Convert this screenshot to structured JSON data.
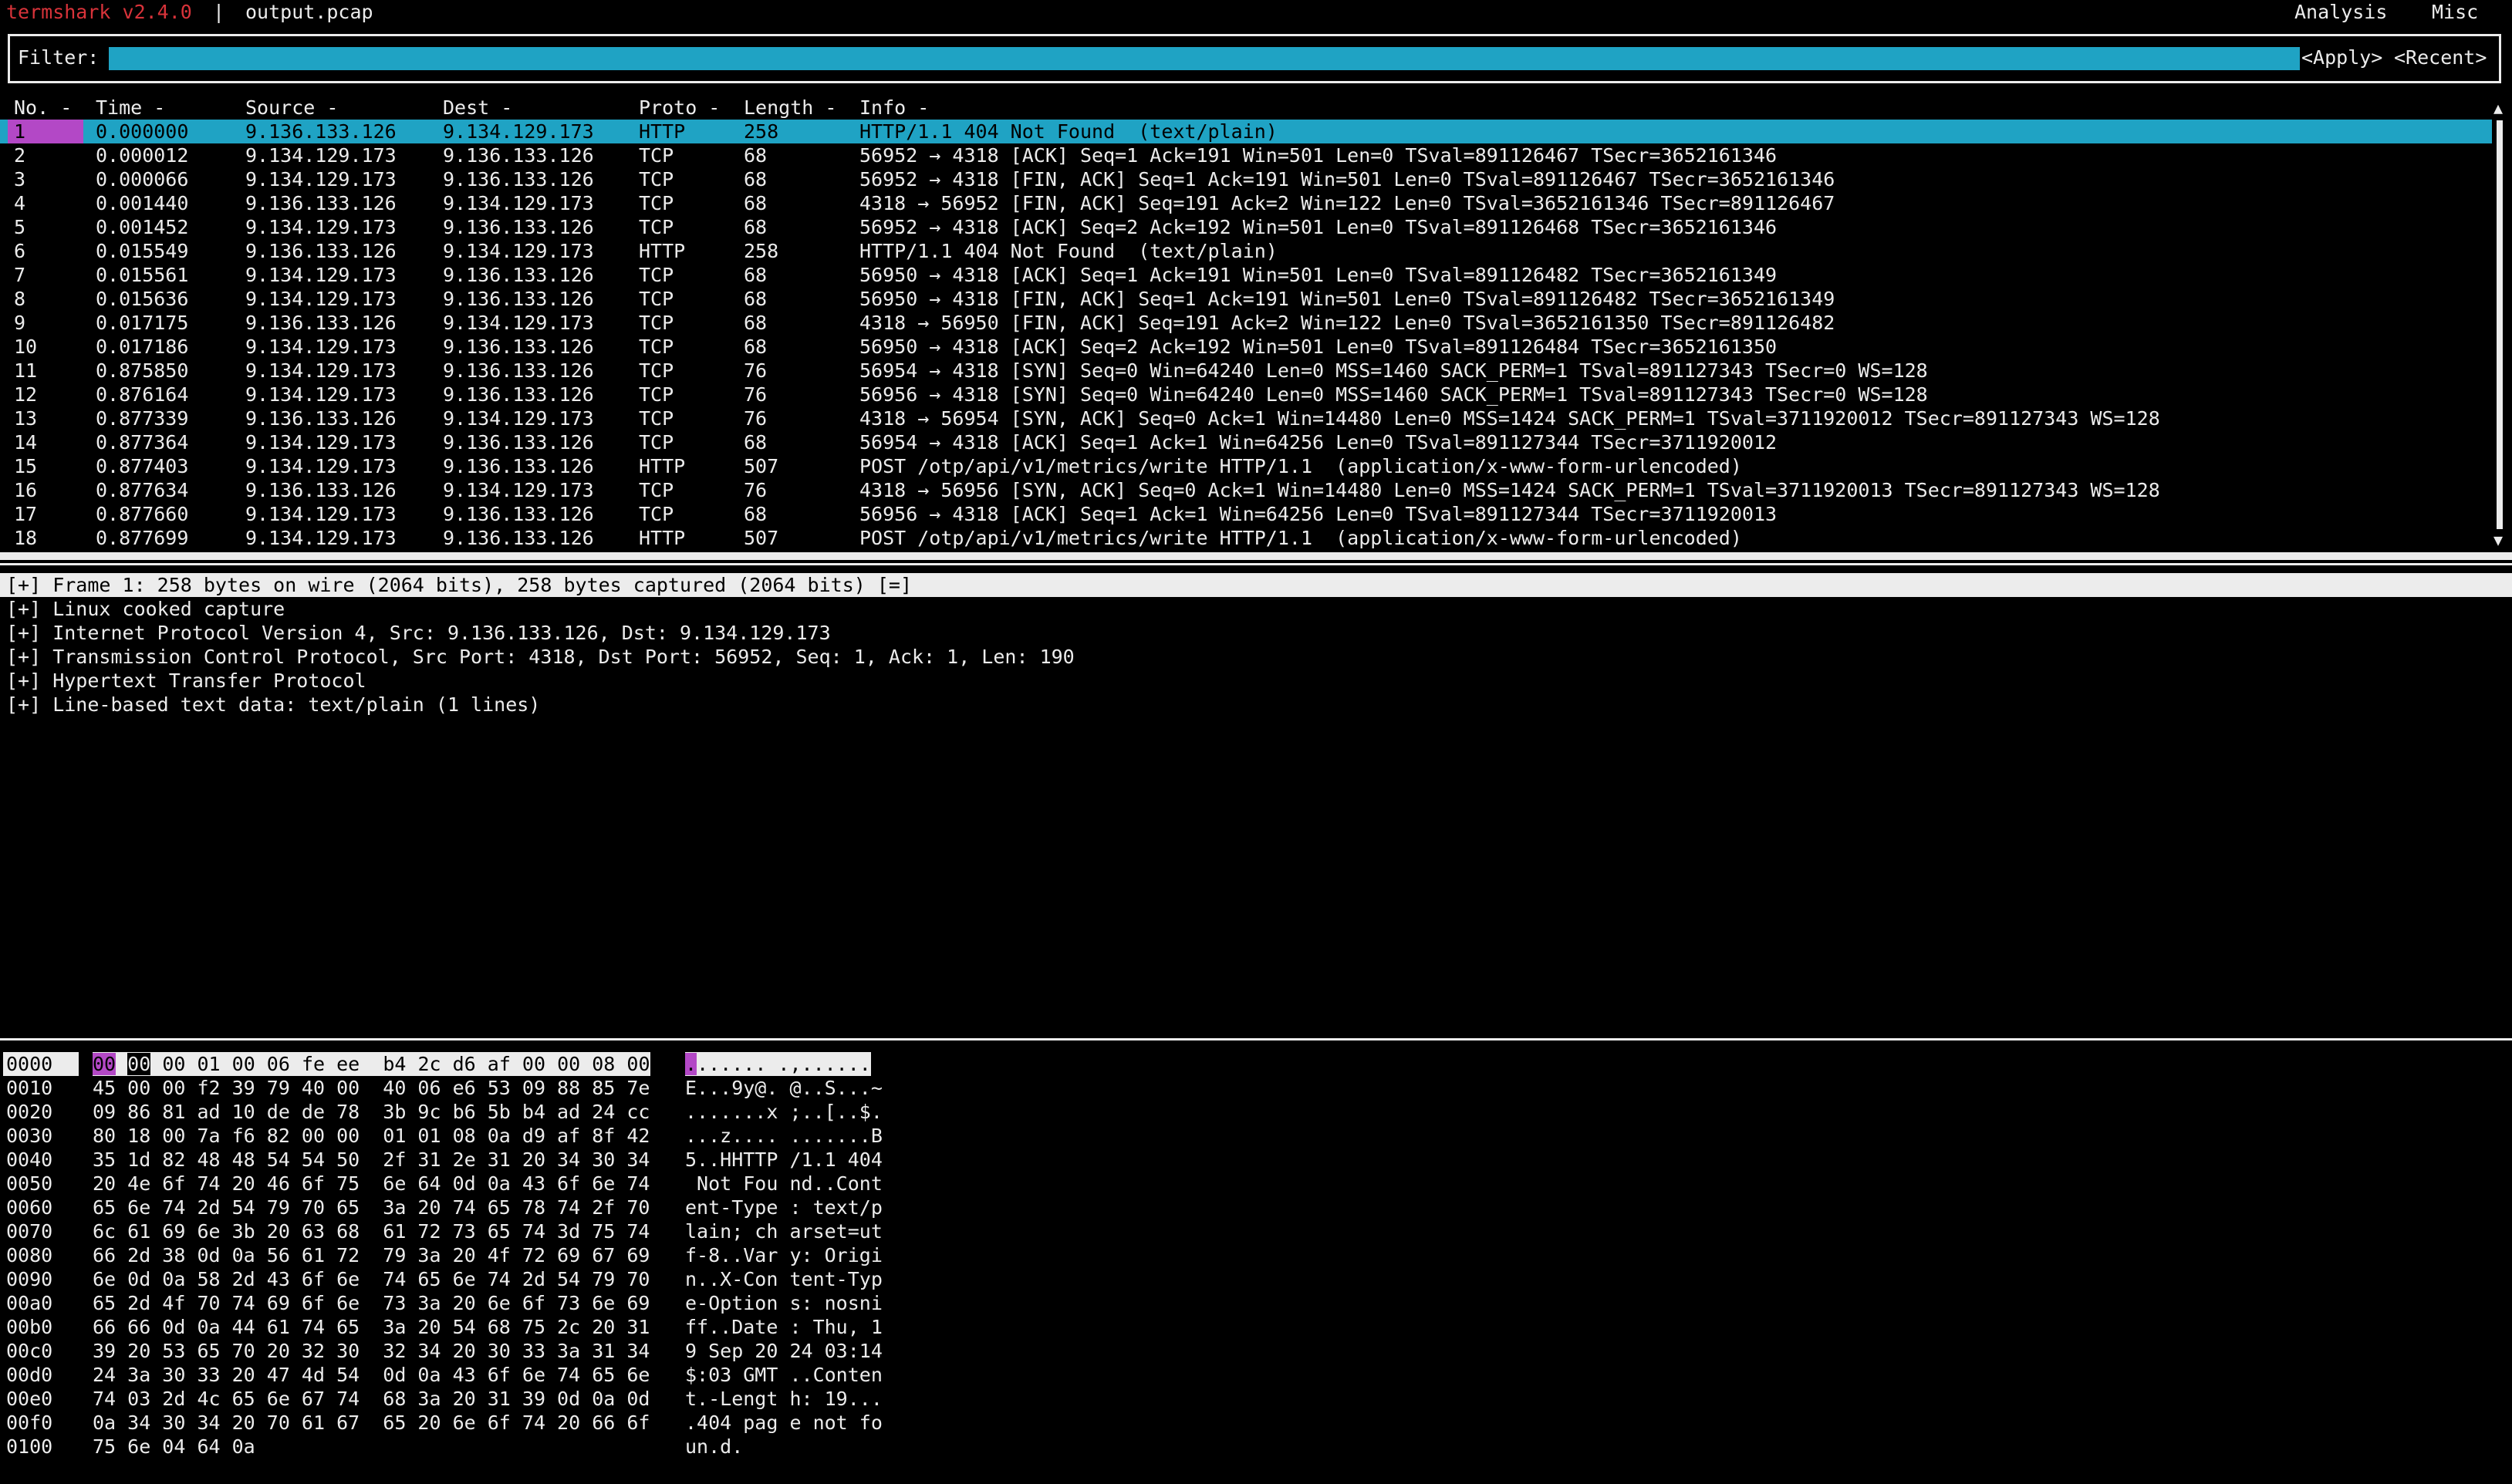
{
  "topbar": {
    "app_name": "termshark v2.4.0",
    "separator": "|",
    "file_name": "output.pcap",
    "menu": [
      "Analysis",
      "Misc"
    ]
  },
  "filter": {
    "label": "Filter:",
    "value": "",
    "apply_label": "<Apply>",
    "recent_label": "<Recent>"
  },
  "columns": {
    "no": "No. -",
    "time": "Time -",
    "source": "Source -",
    "dest": "Dest -",
    "proto": "Proto -",
    "length": "Length -",
    "info": "Info -"
  },
  "packets": [
    {
      "no": "1",
      "time": "0.000000",
      "src": "9.136.133.126",
      "dst": "9.134.129.173",
      "proto": "HTTP",
      "len": "258",
      "info": "HTTP/1.1 404 Not Found  (text/plain)"
    },
    {
      "no": "2",
      "time": "0.000012",
      "src": "9.134.129.173",
      "dst": "9.136.133.126",
      "proto": "TCP",
      "len": "68",
      "info": "56952 → 4318 [ACK] Seq=1 Ack=191 Win=501 Len=0 TSval=891126467 TSecr=3652161346"
    },
    {
      "no": "3",
      "time": "0.000066",
      "src": "9.134.129.173",
      "dst": "9.136.133.126",
      "proto": "TCP",
      "len": "68",
      "info": "56952 → 4318 [FIN, ACK] Seq=1 Ack=191 Win=501 Len=0 TSval=891126467 TSecr=3652161346"
    },
    {
      "no": "4",
      "time": "0.001440",
      "src": "9.136.133.126",
      "dst": "9.134.129.173",
      "proto": "TCP",
      "len": "68",
      "info": "4318 → 56952 [FIN, ACK] Seq=191 Ack=2 Win=122 Len=0 TSval=3652161346 TSecr=891126467"
    },
    {
      "no": "5",
      "time": "0.001452",
      "src": "9.134.129.173",
      "dst": "9.136.133.126",
      "proto": "TCP",
      "len": "68",
      "info": "56952 → 4318 [ACK] Seq=2 Ack=192 Win=501 Len=0 TSval=891126468 TSecr=3652161346"
    },
    {
      "no": "6",
      "time": "0.015549",
      "src": "9.136.133.126",
      "dst": "9.134.129.173",
      "proto": "HTTP",
      "len": "258",
      "info": "HTTP/1.1 404 Not Found  (text/plain)"
    },
    {
      "no": "7",
      "time": "0.015561",
      "src": "9.134.129.173",
      "dst": "9.136.133.126",
      "proto": "TCP",
      "len": "68",
      "info": "56950 → 4318 [ACK] Seq=1 Ack=191 Win=501 Len=0 TSval=891126482 TSecr=3652161349"
    },
    {
      "no": "8",
      "time": "0.015636",
      "src": "9.134.129.173",
      "dst": "9.136.133.126",
      "proto": "TCP",
      "len": "68",
      "info": "56950 → 4318 [FIN, ACK] Seq=1 Ack=191 Win=501 Len=0 TSval=891126482 TSecr=3652161349"
    },
    {
      "no": "9",
      "time": "0.017175",
      "src": "9.136.133.126",
      "dst": "9.134.129.173",
      "proto": "TCP",
      "len": "68",
      "info": "4318 → 56950 [FIN, ACK] Seq=191 Ack=2 Win=122 Len=0 TSval=3652161350 TSecr=891126482"
    },
    {
      "no": "10",
      "time": "0.017186",
      "src": "9.134.129.173",
      "dst": "9.136.133.126",
      "proto": "TCP",
      "len": "68",
      "info": "56950 → 4318 [ACK] Seq=2 Ack=192 Win=501 Len=0 TSval=891126484 TSecr=3652161350"
    },
    {
      "no": "11",
      "time": "0.875850",
      "src": "9.134.129.173",
      "dst": "9.136.133.126",
      "proto": "TCP",
      "len": "76",
      "info": "56954 → 4318 [SYN] Seq=0 Win=64240 Len=0 MSS=1460 SACK_PERM=1 TSval=891127343 TSecr=0 WS=128"
    },
    {
      "no": "12",
      "time": "0.876164",
      "src": "9.134.129.173",
      "dst": "9.136.133.126",
      "proto": "TCP",
      "len": "76",
      "info": "56956 → 4318 [SYN] Seq=0 Win=64240 Len=0 MSS=1460 SACK_PERM=1 TSval=891127343 TSecr=0 WS=128"
    },
    {
      "no": "13",
      "time": "0.877339",
      "src": "9.136.133.126",
      "dst": "9.134.129.173",
      "proto": "TCP",
      "len": "76",
      "info": "4318 → 56954 [SYN, ACK] Seq=0 Ack=1 Win=14480 Len=0 MSS=1424 SACK_PERM=1 TSval=3711920012 TSecr=891127343 WS=128"
    },
    {
      "no": "14",
      "time": "0.877364",
      "src": "9.134.129.173",
      "dst": "9.136.133.126",
      "proto": "TCP",
      "len": "68",
      "info": "56954 → 4318 [ACK] Seq=1 Ack=1 Win=64256 Len=0 TSval=891127344 TSecr=3711920012"
    },
    {
      "no": "15",
      "time": "0.877403",
      "src": "9.134.129.173",
      "dst": "9.136.133.126",
      "proto": "HTTP",
      "len": "507",
      "info": "POST /otp/api/v1/metrics/write HTTP/1.1  (application/x-www-form-urlencoded)"
    },
    {
      "no": "16",
      "time": "0.877634",
      "src": "9.136.133.126",
      "dst": "9.134.129.173",
      "proto": "TCP",
      "len": "76",
      "info": "4318 → 56956 [SYN, ACK] Seq=0 Ack=1 Win=14480 Len=0 MSS=1424 SACK_PERM=1 TSval=3711920013 TSecr=891127343 WS=128"
    },
    {
      "no": "17",
      "time": "0.877660",
      "src": "9.134.129.173",
      "dst": "9.136.133.126",
      "proto": "TCP",
      "len": "68",
      "info": "56956 → 4318 [ACK] Seq=1 Ack=1 Win=64256 Len=0 TSval=891127344 TSecr=3711920013"
    },
    {
      "no": "18",
      "time": "0.877699",
      "src": "9.134.129.173",
      "dst": "9.136.133.126",
      "proto": "HTTP",
      "len": "507",
      "info": "POST /otp/api/v1/metrics/write HTTP/1.1  (application/x-www-form-urlencoded)"
    }
  ],
  "scrollbar": {
    "up": "▲",
    "down": "▼"
  },
  "tree": [
    "[+] Frame 1: 258 bytes on wire (2064 bits), 258 bytes captured (2064 bits) [=]",
    "[+] Linux cooked capture",
    "[+] Internet Protocol Version 4, Src: 9.136.133.126, Dst: 9.134.129.173",
    "[+] Transmission Control Protocol, Src Port: 4318, Dst Port: 56952, Seq: 1, Ack: 1, Len: 190",
    "[+] Hypertext Transfer Protocol",
    "[+] Line-based text data: text/plain (1 lines)"
  ],
  "hex_first": {
    "offset": "0000",
    "byte0": "00",
    "byte1": "00",
    "bytes_rest": "00 01 00 06 fe ee  b4 2c d6 af 00 00 08 00",
    "ascii_mark": ".",
    "ascii_rest": "...... .,......"
  },
  "hex": [
    {
      "off": "0010",
      "bytes": "45 00 00 f2 39 79 40 00  40 06 e6 53 09 88 85 7e",
      "ascii": "E...9y@. @..S...~"
    },
    {
      "off": "0020",
      "bytes": "09 86 81 ad 10 de de 78  3b 9c b6 5b b4 ad 24 cc",
      "ascii": ".......x ;..[..$."
    },
    {
      "off": "0030",
      "bytes": "80 18 00 7a f6 82 00 00  01 01 08 0a d9 af 8f 42",
      "ascii": "...z.... .......B"
    },
    {
      "off": "0040",
      "bytes": "35 1d 82 48 48 54 54 50  2f 31 2e 31 20 34 30 34",
      "ascii": "5..HHTTP /1.1 404"
    },
    {
      "off": "0050",
      "bytes": "20 4e 6f 74 20 46 6f 75  6e 64 0d 0a 43 6f 6e 74",
      "ascii": " Not Fou nd..Cont"
    },
    {
      "off": "0060",
      "bytes": "65 6e 74 2d 54 79 70 65  3a 20 74 65 78 74 2f 70",
      "ascii": "ent-Type : text/p"
    },
    {
      "off": "0070",
      "bytes": "6c 61 69 6e 3b 20 63 68  61 72 73 65 74 3d 75 74",
      "ascii": "lain; ch arset=ut"
    },
    {
      "off": "0080",
      "bytes": "66 2d 38 0d 0a 56 61 72  79 3a 20 4f 72 69 67 69",
      "ascii": "f-8..Var y: Origi"
    },
    {
      "off": "0090",
      "bytes": "6e 0d 0a 58 2d 43 6f 6e  74 65 6e 74 2d 54 79 70",
      "ascii": "n..X-Con tent-Typ"
    },
    {
      "off": "00a0",
      "bytes": "65 2d 4f 70 74 69 6f 6e  73 3a 20 6e 6f 73 6e 69",
      "ascii": "e-Option s: nosni"
    },
    {
      "off": "00b0",
      "bytes": "66 66 0d 0a 44 61 74 65  3a 20 54 68 75 2c 20 31",
      "ascii": "ff..Date : Thu, 1"
    },
    {
      "off": "00c0",
      "bytes": "39 20 53 65 70 20 32 30  32 34 20 30 33 3a 31 34",
      "ascii": "9 Sep 20 24 03:14"
    },
    {
      "off": "00d0",
      "bytes": "24 3a 30 33 20 47 4d 54  0d 0a 43 6f 6e 74 65 6e",
      "ascii": "$:03 GMT ..Conten"
    },
    {
      "off": "00e0",
      "bytes": "74 03 2d 4c 65 6e 67 74  68 3a 20 31 39 0d 0a 0d",
      "ascii": "t.-Lengt h: 19..."
    },
    {
      "off": "00f0",
      "bytes": "0a 34 30 34 20 70 61 67  65 20 6e 6f 74 20 66 6f",
      "ascii": ".404 pag e not fo"
    },
    {
      "off": "0100",
      "bytes": "75 6e 04 64 0a",
      "ascii": "un.d."
    }
  ],
  "colors": {
    "accent_cyan": "#1fa3c4",
    "accent_magenta": "#b348c6",
    "brand_red": "#d8333a",
    "background": "#000000",
    "foreground": "#ececec"
  }
}
